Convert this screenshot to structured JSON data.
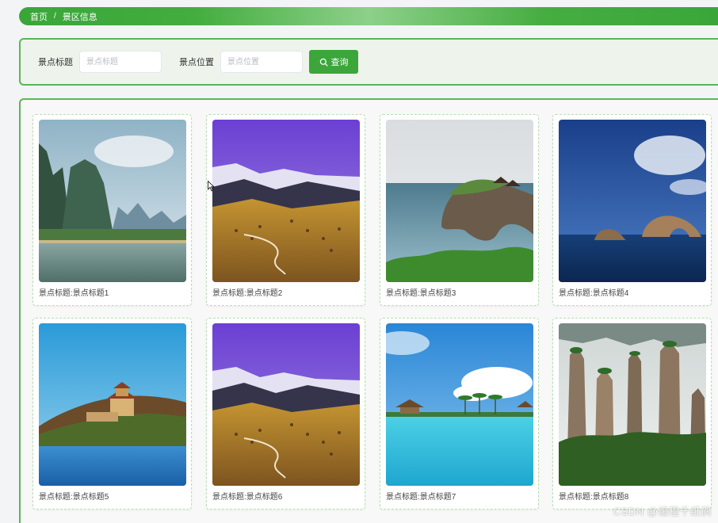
{
  "breadcrumb": {
    "home": "首页",
    "separator": "/",
    "current": "景区信息"
  },
  "search": {
    "title_label": "景点标题",
    "title_placeholder": "景点标题",
    "location_label": "景点位置",
    "location_placeholder": "景点位置",
    "button_label": "查询",
    "button_icon": "search-icon"
  },
  "cards": [
    {
      "caption": "景点标题:景点标题1",
      "scene": "karst-river"
    },
    {
      "caption": "景点标题:景点标题2",
      "scene": "mountain-village"
    },
    {
      "caption": "景点标题:景点标题3",
      "scene": "sea-arch-temple"
    },
    {
      "caption": "景点标题:景点标题4",
      "scene": "ocean-rocks"
    },
    {
      "caption": "景点标题:景点标题5",
      "scene": "palace-lake"
    },
    {
      "caption": "景点标题:景点标题6",
      "scene": "mountain-village"
    },
    {
      "caption": "景点标题:景点标题7",
      "scene": "pool-palms"
    },
    {
      "caption": "景点标题:景点标题8",
      "scene": "stone-pillars"
    }
  ],
  "watermark": "CSDN @编程千纸鹤",
  "colors": {
    "accent": "#3ca63b",
    "panel_border": "#5ab55a",
    "panel_bg": "#eef4ec"
  }
}
